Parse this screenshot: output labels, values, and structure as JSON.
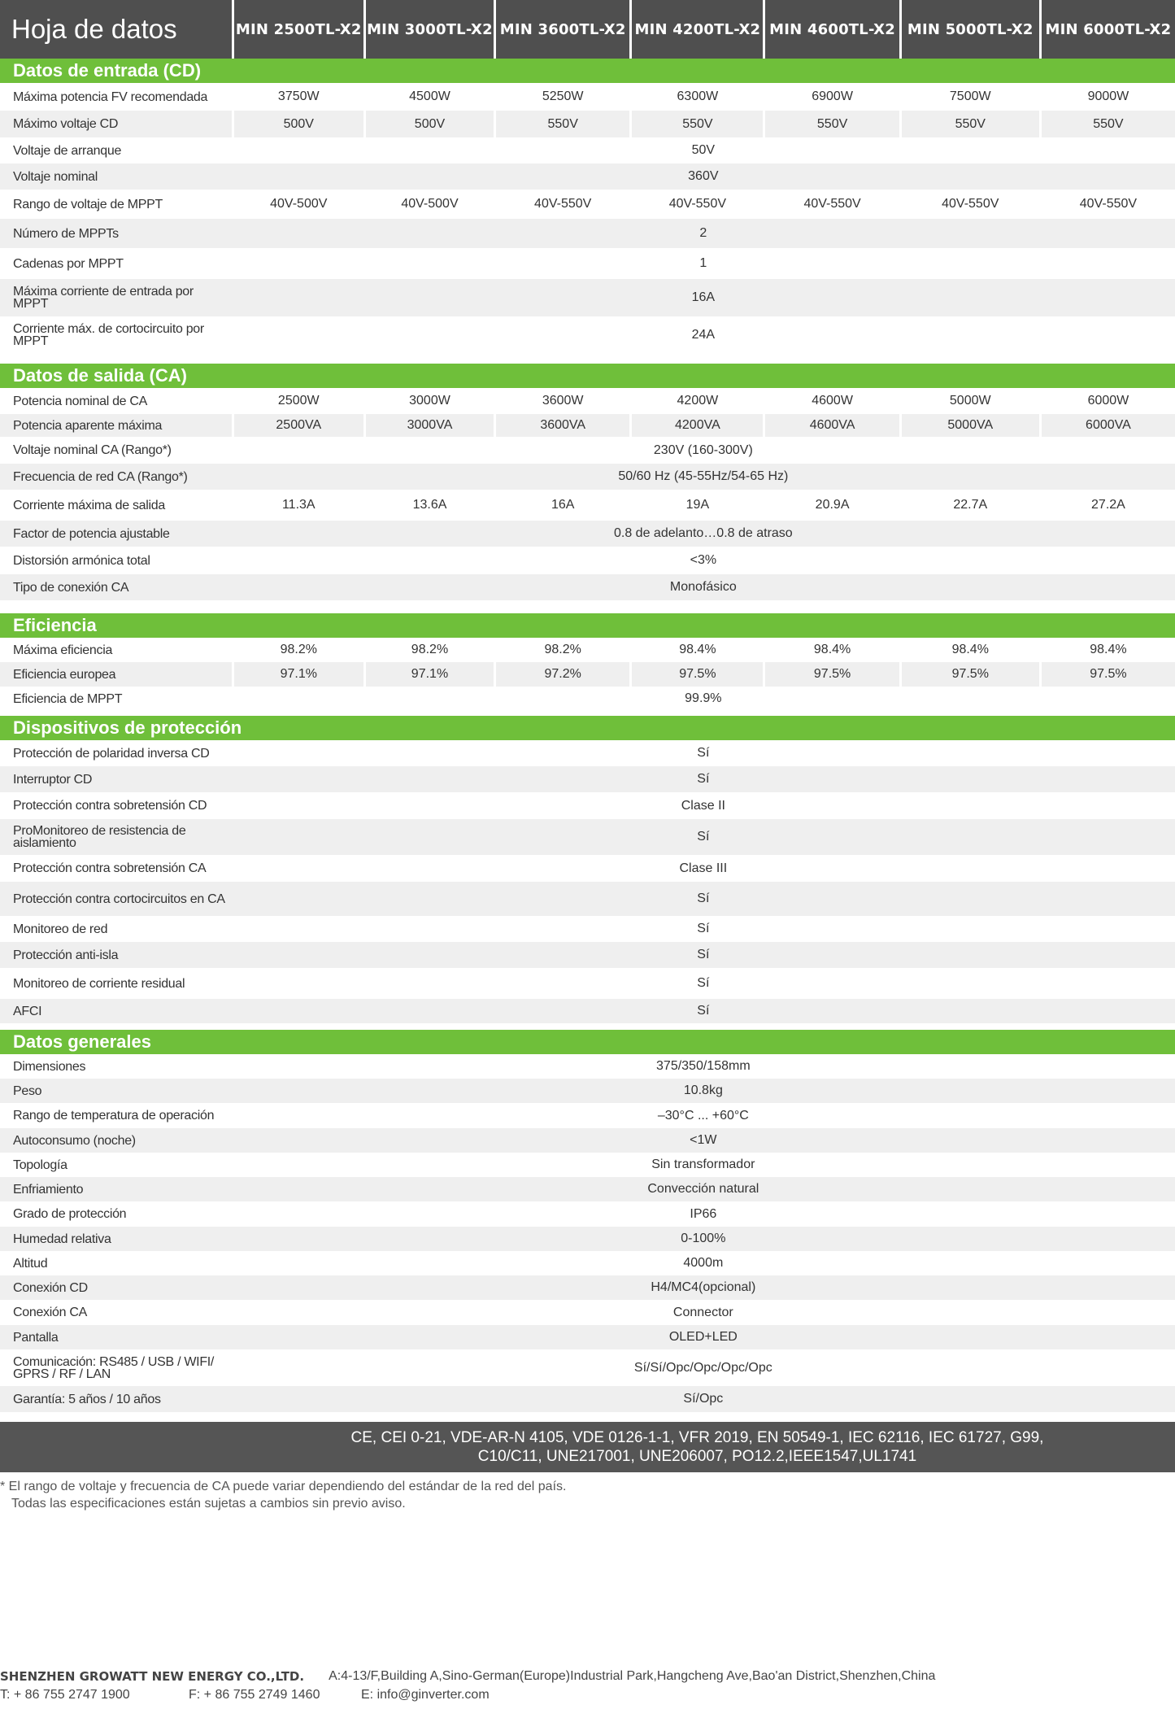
{
  "header": {
    "title": "Hoja de datos",
    "models": [
      "MIN 2500TL-X2",
      "MIN 3000TL-X2",
      "MIN 3600TL-X2",
      "MIN 4200TL-X2",
      "MIN 4600TL-X2",
      "MIN 5000TL-X2",
      "MIN 6000TL-X2"
    ]
  },
  "sections": [
    {
      "title": "Datos de entrada (CD)",
      "rows": [
        {
          "label": "Máxima potencia FV recomendada",
          "values": [
            "3750W",
            "4500W",
            "5250W",
            "6300W",
            "6900W",
            "7500W",
            "9000W"
          ]
        },
        {
          "label": "Máximo voltaje CD",
          "values": [
            "500V",
            "500V",
            "550V",
            "550V",
            "550V",
            "550V",
            "550V"
          ]
        },
        {
          "label": "Voltaje de arranque",
          "value": "50V"
        },
        {
          "label": "Voltaje nominal",
          "value": "360V"
        },
        {
          "label": "Rango de voltaje de MPPT",
          "values": [
            "40V-500V",
            "40V-500V",
            "40V-550V",
            "40V-550V",
            "40V-550V",
            "40V-550V",
            "40V-550V"
          ]
        },
        {
          "label": "Número de MPPTs",
          "value": "2"
        },
        {
          "label": "Cadenas por MPPT",
          "value": "1"
        },
        {
          "label": "Máxima corriente de entrada por MPPT",
          "value": "16A"
        },
        {
          "label": "Corriente máx. de cortocircuito por MPPT",
          "value": "24A"
        }
      ]
    },
    {
      "title": "Datos de salida (CA)",
      "rows": [
        {
          "label": "Potencia nominal de CA",
          "values": [
            "2500W",
            "3000W",
            "3600W",
            "4200W",
            "4600W",
            "5000W",
            "6000W"
          ]
        },
        {
          "label": "Potencia aparente máxima",
          "values": [
            "2500VA",
            "3000VA",
            "3600VA",
            "4200VA",
            "4600VA",
            "5000VA",
            "6000VA"
          ]
        },
        {
          "label": "Voltaje nominal CA (Rango*)",
          "value": "230V (160-300V)"
        },
        {
          "label": "Frecuencia de red CA (Rango*)",
          "value": "50/60 Hz (45-55Hz/54-65 Hz)"
        },
        {
          "label": "Corriente máxima de salida",
          "values": [
            "11.3A",
            "13.6A",
            "16A",
            "19A",
            "20.9A",
            "22.7A",
            "27.2A"
          ]
        },
        {
          "label": "Factor de potencia ajustable",
          "value": "0.8 de adelanto…0.8 de atraso"
        },
        {
          "label": "Distorsión armónica total",
          "value": "<3%"
        },
        {
          "label": "Tipo de conexión CA",
          "value": "Monofásico"
        }
      ]
    },
    {
      "title": "Eficiencia",
      "rows": [
        {
          "label": "Máxima eficiencia",
          "values": [
            "98.2%",
            "98.2%",
            "98.2%",
            "98.4%",
            "98.4%",
            "98.4%",
            "98.4%"
          ]
        },
        {
          "label": "Eficiencia europea",
          "values": [
            "97.1%",
            "97.1%",
            "97.2%",
            "97.5%",
            "97.5%",
            "97.5%",
            "97.5%"
          ]
        },
        {
          "label": "Eficiencia de MPPT",
          "value": "99.9%"
        }
      ]
    },
    {
      "title": "Dispositivos de protección",
      "rows": [
        {
          "label": "Protección de polaridad inversa CD",
          "value": "Sí"
        },
        {
          "label": "Interruptor CD",
          "value": "Sí"
        },
        {
          "label": "Protección contra sobretensión CD",
          "value": "Clase II"
        },
        {
          "label": "ProMonitoreo de resistencia de aislamiento",
          "value": "Sí"
        },
        {
          "label": "Protección contra sobretensión CA",
          "value": "Clase III"
        },
        {
          "label": "Protección contra cortocircuitos en CA",
          "value": "Sí"
        },
        {
          "label": "Monitoreo de red",
          "value": "Sí"
        },
        {
          "label": "Protección anti-isla",
          "value": "Sí"
        },
        {
          "label": "Monitoreo de corriente residual",
          "value": "Sí"
        },
        {
          "label": "AFCI",
          "value": "Sí"
        }
      ]
    },
    {
      "title": "Datos generales",
      "rows": [
        {
          "label": "Dimensiones",
          "value": "375/350/158mm"
        },
        {
          "label": "Peso",
          "value": "10.8kg"
        },
        {
          "label": "Rango de temperatura de operación",
          "value": "–30°C ... +60°C"
        },
        {
          "label": "Autoconsumo (noche)",
          "value": "<1W"
        },
        {
          "label": "Topología",
          "value": "Sin transformador"
        },
        {
          "label": "Enfriamiento",
          "value": "Convección natural"
        },
        {
          "label": "Grado de protección",
          "value": "IP66"
        },
        {
          "label": "Humedad relativa",
          "value": "0-100%"
        },
        {
          "label": "Altitud",
          "value": "4000m"
        },
        {
          "label": "Conexión CD",
          "value": "H4/MC4(opcional)"
        },
        {
          "label": "Conexión CA",
          "value": "Connector"
        },
        {
          "label": "Pantalla",
          "value": "OLED+LED"
        },
        {
          "label": "Comunicación: RS485 / USB / WIFI/ GPRS / RF / LAN",
          "value": "Sí/Sí/Opc/Opc/Opc/Opc"
        },
        {
          "label": "Garantía: 5 años / 10 años",
          "value": "Sí/Opc"
        }
      ]
    }
  ],
  "certifications": {
    "line1": "CE, CEI 0-21, VDE-AR-N 4105, VDE 0126-1-1, VFR 2019, EN 50549-1, IEC 62116, IEC 61727, G99,",
    "line2": "C10/C11, UNE217001, UNE206007, PO12.2,IEEE1547,UL1741"
  },
  "notes": {
    "line1": "* El rango de voltaje y frecuencia de CA puede variar dependiendo del estándar de la red del país.",
    "line2": "Todas las especificaciones están sujetas a cambios sin previo aviso."
  },
  "footer": {
    "company": "SHENZHEN GROWATT NEW ENERGY CO.,LTD.",
    "address": "A:4-13/F,Building A,Sino-German(Europe)Industrial Park,Hangcheng Ave,Bao'an District,Shenzhen,China",
    "phone": "T:  + 86 755 2747 1900",
    "fax": "F:  + 86 755 2749 1460",
    "email": "E:  info@ginverter.com"
  },
  "colors": {
    "header_bg": "#4f4f4f",
    "section_green": "#6fbf3a",
    "row_shade": "#efefef",
    "cert_bg": "#555555"
  }
}
